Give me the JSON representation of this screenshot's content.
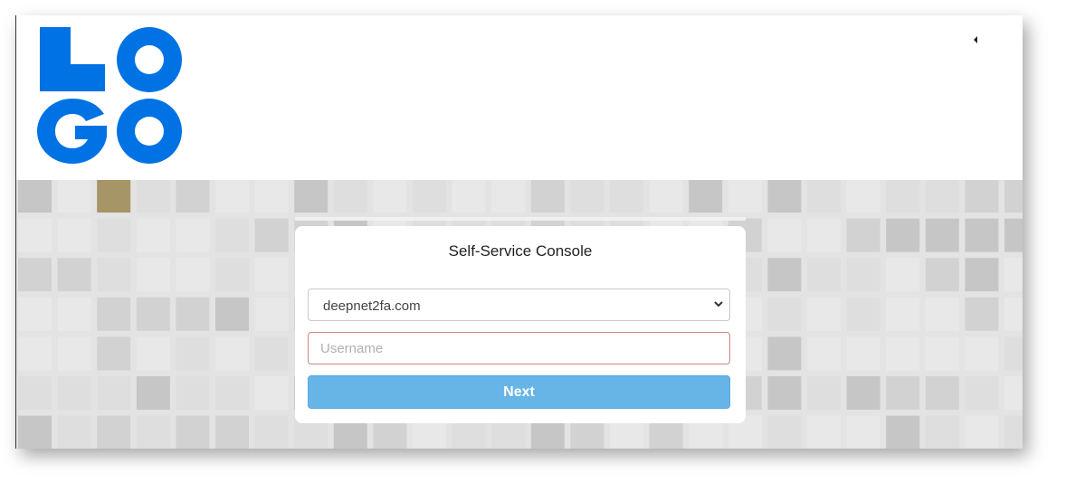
{
  "header": {
    "logo_text": "LOGO",
    "logo_color": "#0072e3",
    "menu_toggle_icon": "caret-left-icon"
  },
  "background": {
    "pattern": "gray-tile-mosaic",
    "tile_colors": [
      "#e8e8e8",
      "#dedede",
      "#d2d2d2",
      "#c6c6c6",
      "#a69566"
    ]
  },
  "login_card": {
    "title": "Self-Service Console",
    "domain_select": {
      "value": "deepnet2fa.com",
      "icon": "chevron-down-icon"
    },
    "username_field": {
      "placeholder": "Username",
      "value": ""
    },
    "next_button": {
      "label": "Next",
      "color": "#66b5e6"
    }
  }
}
